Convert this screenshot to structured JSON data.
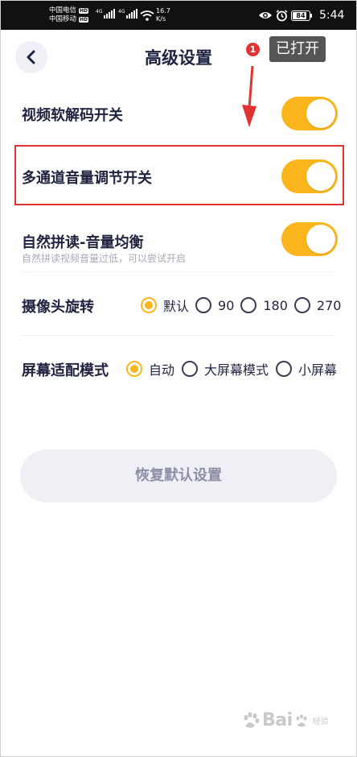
{
  "status_bar": {
    "carrier_1": "中国电信",
    "carrier_2": "中国移动",
    "hd_badge": "HD",
    "network_type": "4G",
    "speed_value": "16.7",
    "speed_unit": "K/s",
    "battery_level": "84",
    "battery_fraction": 0.84,
    "time": "5:44"
  },
  "header": {
    "title": "高级设置",
    "back_icon": "chevron-left-icon"
  },
  "annotation": {
    "number": "1",
    "tooltip": "已打开"
  },
  "settings": {
    "soft_decode": {
      "label": "视频软解码开关",
      "on": true
    },
    "multichannel_volume": {
      "label": "多通道音量调节开关",
      "on": true
    },
    "natural_reading": {
      "label": "自然拼读-音量均衡",
      "description": "自然拼读视频音量过低，可以尝试开启",
      "on": true
    },
    "camera_rotation": {
      "label": "摄像头旋转",
      "options": [
        "默认",
        "90",
        "180",
        "270"
      ],
      "selected": "默认"
    },
    "screen_mode": {
      "label": "屏幕适配模式",
      "options": [
        "自动",
        "大屏幕模式",
        "小屏幕"
      ],
      "selected": "自动"
    }
  },
  "reset_button": {
    "label": "恢复默认设置"
  },
  "watermark": {
    "text": "Bai",
    "sub": "经验"
  },
  "colors": {
    "accent": "#fbb61e",
    "title": "#1f2340",
    "highlight": "#e03434",
    "subtext": "#a6a9bb",
    "button_bg": "#eff0f6"
  }
}
